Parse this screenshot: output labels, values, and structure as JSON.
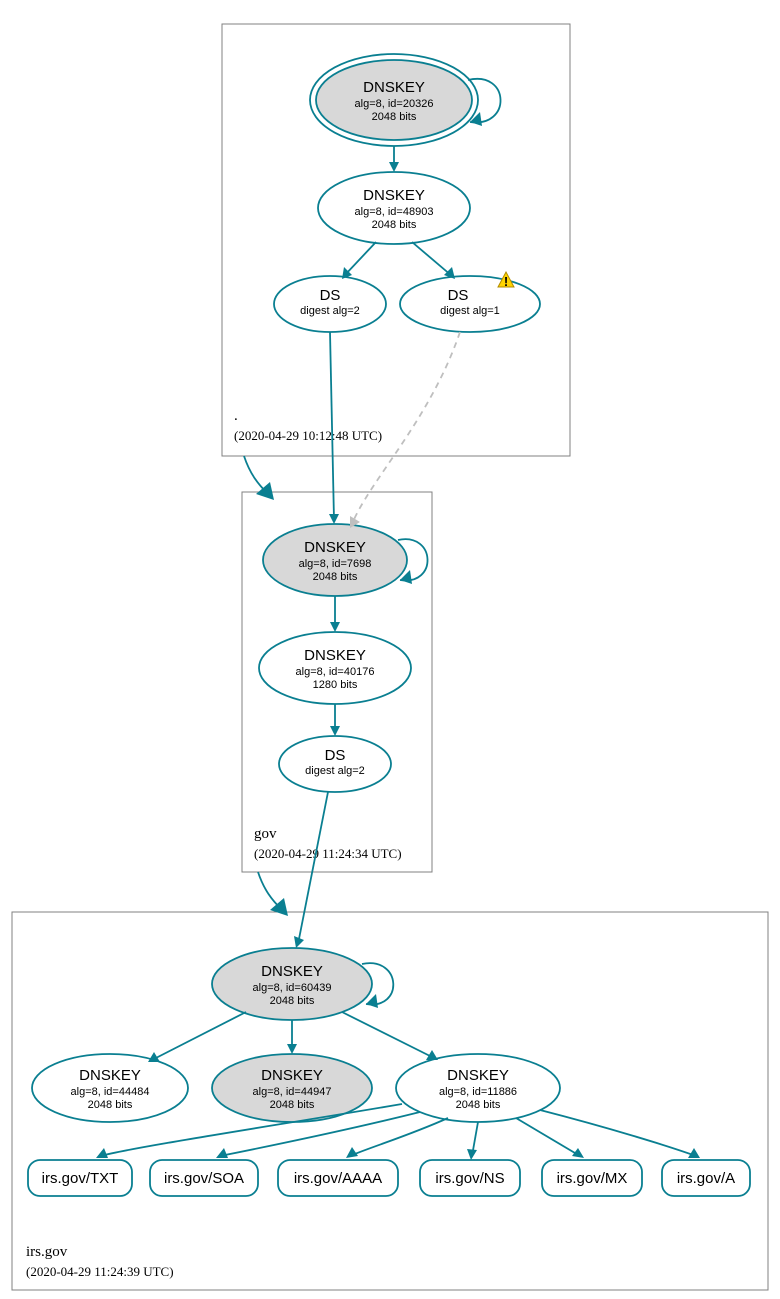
{
  "colors": {
    "accent": "#0a7f91",
    "node_fill_gray": "#d8d8d8",
    "node_fill_white": "#ffffff",
    "box_stroke": "#808080",
    "dash": "#bfbfbf"
  },
  "zones": {
    "root": {
      "label": ".",
      "timestamp": "(2020-04-29 10:12:48 UTC)"
    },
    "gov": {
      "label": "gov",
      "timestamp": "(2020-04-29 11:24:34 UTC)"
    },
    "irsgov": {
      "label": "irs.gov",
      "timestamp": "(2020-04-29 11:24:39 UTC)"
    }
  },
  "nodes": {
    "root_ksk": {
      "title": "DNSKEY",
      "line2": "alg=8, id=20326",
      "line3": "2048 bits"
    },
    "root_zsk": {
      "title": "DNSKEY",
      "line2": "alg=8, id=48903",
      "line3": "2048 bits"
    },
    "root_ds2": {
      "title": "DS",
      "line2": "digest alg=2"
    },
    "root_ds1": {
      "title": "DS",
      "line2": "digest alg=1",
      "warn": true
    },
    "gov_ksk": {
      "title": "DNSKEY",
      "line2": "alg=8, id=7698",
      "line3": "2048 bits"
    },
    "gov_zsk": {
      "title": "DNSKEY",
      "line2": "alg=8, id=40176",
      "line3": "1280 bits"
    },
    "gov_ds": {
      "title": "DS",
      "line2": "digest alg=2"
    },
    "irs_ksk": {
      "title": "DNSKEY",
      "line2": "alg=8, id=60439",
      "line3": "2048 bits"
    },
    "irs_k44484": {
      "title": "DNSKEY",
      "line2": "alg=8, id=44484",
      "line3": "2048 bits"
    },
    "irs_k44947": {
      "title": "DNSKEY",
      "line2": "alg=8, id=44947",
      "line3": "2048 bits"
    },
    "irs_k11886": {
      "title": "DNSKEY",
      "line2": "alg=8, id=11886",
      "line3": "2048 bits"
    }
  },
  "rrsets": {
    "txt": "irs.gov/TXT",
    "soa": "irs.gov/SOA",
    "aaaa": "irs.gov/AAAA",
    "ns": "irs.gov/NS",
    "mx": "irs.gov/MX",
    "a": "irs.gov/A"
  }
}
